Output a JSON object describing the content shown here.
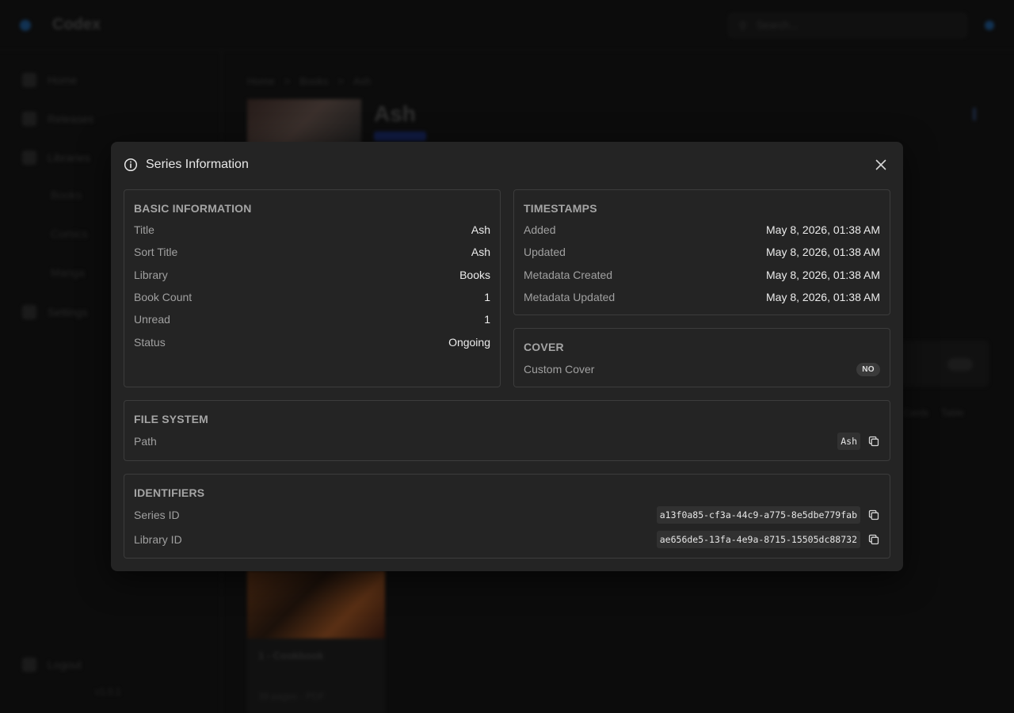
{
  "app": {
    "title": "Codex",
    "search_placeholder": "Search...",
    "nav": [
      "Home",
      "Releases",
      "Libraries"
    ],
    "nav_sub": [
      "Books",
      "Comics",
      "Manga"
    ],
    "settings": "Settings",
    "logout": "Logout",
    "version": "v1.0.1"
  },
  "background": {
    "breadcrumb": [
      "Home",
      ">",
      "Books",
      ">",
      "Ash"
    ],
    "series_title": "Ash",
    "card_title": "1 - Cookbook",
    "card_meta": "39 pages · PDF",
    "views": [
      "Cards",
      "Table"
    ]
  },
  "modal": {
    "title": "Series Information",
    "basic": {
      "heading": "BASIC INFORMATION",
      "rows": [
        {
          "label": "Title",
          "value": "Ash"
        },
        {
          "label": "Sort Title",
          "value": "Ash"
        },
        {
          "label": "Library",
          "value": "Books"
        },
        {
          "label": "Book Count",
          "value": "1"
        },
        {
          "label": "Unread",
          "value": "1"
        },
        {
          "label": "Status",
          "value": "Ongoing"
        }
      ]
    },
    "timestamps": {
      "heading": "TIMESTAMPS",
      "rows": [
        {
          "label": "Added",
          "value": "May 8, 2026, 01:38 AM"
        },
        {
          "label": "Updated",
          "value": "May 8, 2026, 01:38 AM"
        },
        {
          "label": "Metadata Created",
          "value": "May 8, 2026, 01:38 AM"
        },
        {
          "label": "Metadata Updated",
          "value": "May 8, 2026, 01:38 AM"
        }
      ]
    },
    "cover": {
      "heading": "COVER",
      "label": "Custom Cover",
      "badge": "NO"
    },
    "file_system": {
      "heading": "FILE SYSTEM",
      "label": "Path",
      "value": "Ash"
    },
    "identifiers": {
      "heading": "IDENTIFIERS",
      "rows": [
        {
          "label": "Series ID",
          "value": "a13f0a85-cf3a-44c9-a775-8e5dbe779fab"
        },
        {
          "label": "Library ID",
          "value": "ae656de5-13fa-4e9a-8715-15505dc88732"
        }
      ]
    }
  }
}
